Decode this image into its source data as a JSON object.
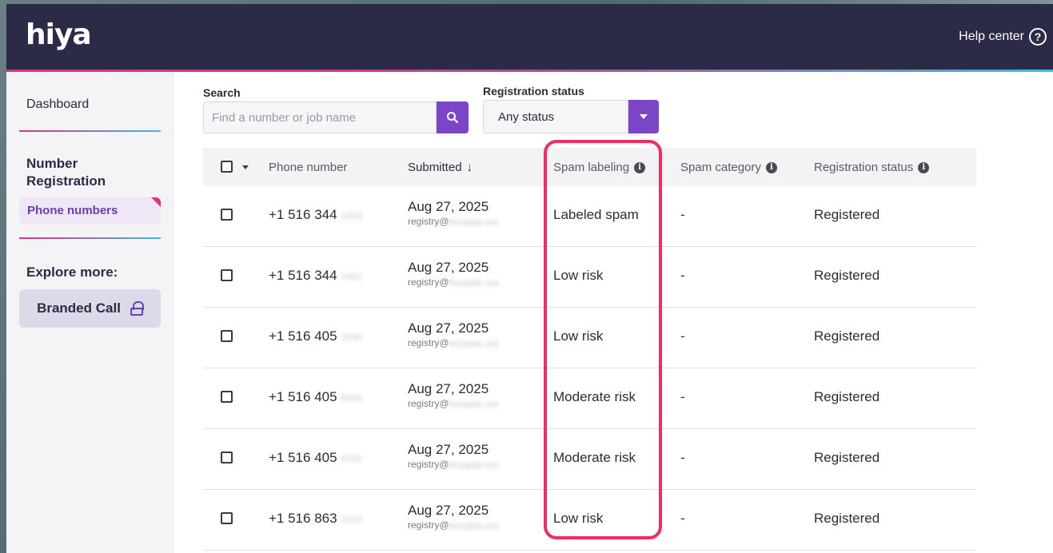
{
  "header": {
    "logo": "hiya",
    "help_label": "Help center",
    "help_icon": "question-circle-icon"
  },
  "sidebar": {
    "dashboard": "Dashboard",
    "section_title": "Number Registration",
    "active_item": "Phone numbers",
    "explore_title": "Explore more:",
    "branded_call": "Branded Call",
    "branded_icon": "lock-icon"
  },
  "filters": {
    "search_label": "Search",
    "search_placeholder": "Find a number or job name",
    "status_label": "Registration status",
    "status_value": "Any status"
  },
  "table": {
    "columns": {
      "phone": "Phone number",
      "submitted": "Submitted",
      "spam_labeling": "Spam labeling",
      "spam_category": "Spam category",
      "registration_status": "Registration status"
    },
    "rows": [
      {
        "prefix": "+1 516 344",
        "suffix": "1459",
        "date": "Aug 27, 2025",
        "email_prefix": "registry@",
        "email_suffix": "firstable.net",
        "spam": "Labeled spam",
        "category": "-",
        "status": "Registered"
      },
      {
        "prefix": "+1 516 344",
        "suffix": "1461",
        "date": "Aug 27, 2025",
        "email_prefix": "registry@",
        "email_suffix": "firstable.net",
        "spam": "Low risk",
        "category": "-",
        "status": "Registered"
      },
      {
        "prefix": "+1 516 405",
        "suffix": "3340",
        "date": "Aug 27, 2025",
        "email_prefix": "registry@",
        "email_suffix": "firstable.net",
        "spam": "Low risk",
        "category": "-",
        "status": "Registered"
      },
      {
        "prefix": "+1 516 405",
        "suffix": "6634",
        "date": "Aug 27, 2025",
        "email_prefix": "registry@",
        "email_suffix": "firstable.net",
        "spam": "Moderate risk",
        "category": "-",
        "status": "Registered"
      },
      {
        "prefix": "+1 516 405",
        "suffix": "6750",
        "date": "Aug 27, 2025",
        "email_prefix": "registry@",
        "email_suffix": "firstable.net",
        "spam": "Moderate risk",
        "category": "-",
        "status": "Registered"
      },
      {
        "prefix": "+1 516 863",
        "suffix": "2019",
        "date": "Aug 27, 2025",
        "email_prefix": "registry@",
        "email_suffix": "firstable.net",
        "spam": "Low risk",
        "category": "-",
        "status": "Registered"
      }
    ]
  },
  "colors": {
    "topbar": "#2c2b47",
    "accent": "#7b45c8",
    "highlight": "#ef2d5e"
  }
}
